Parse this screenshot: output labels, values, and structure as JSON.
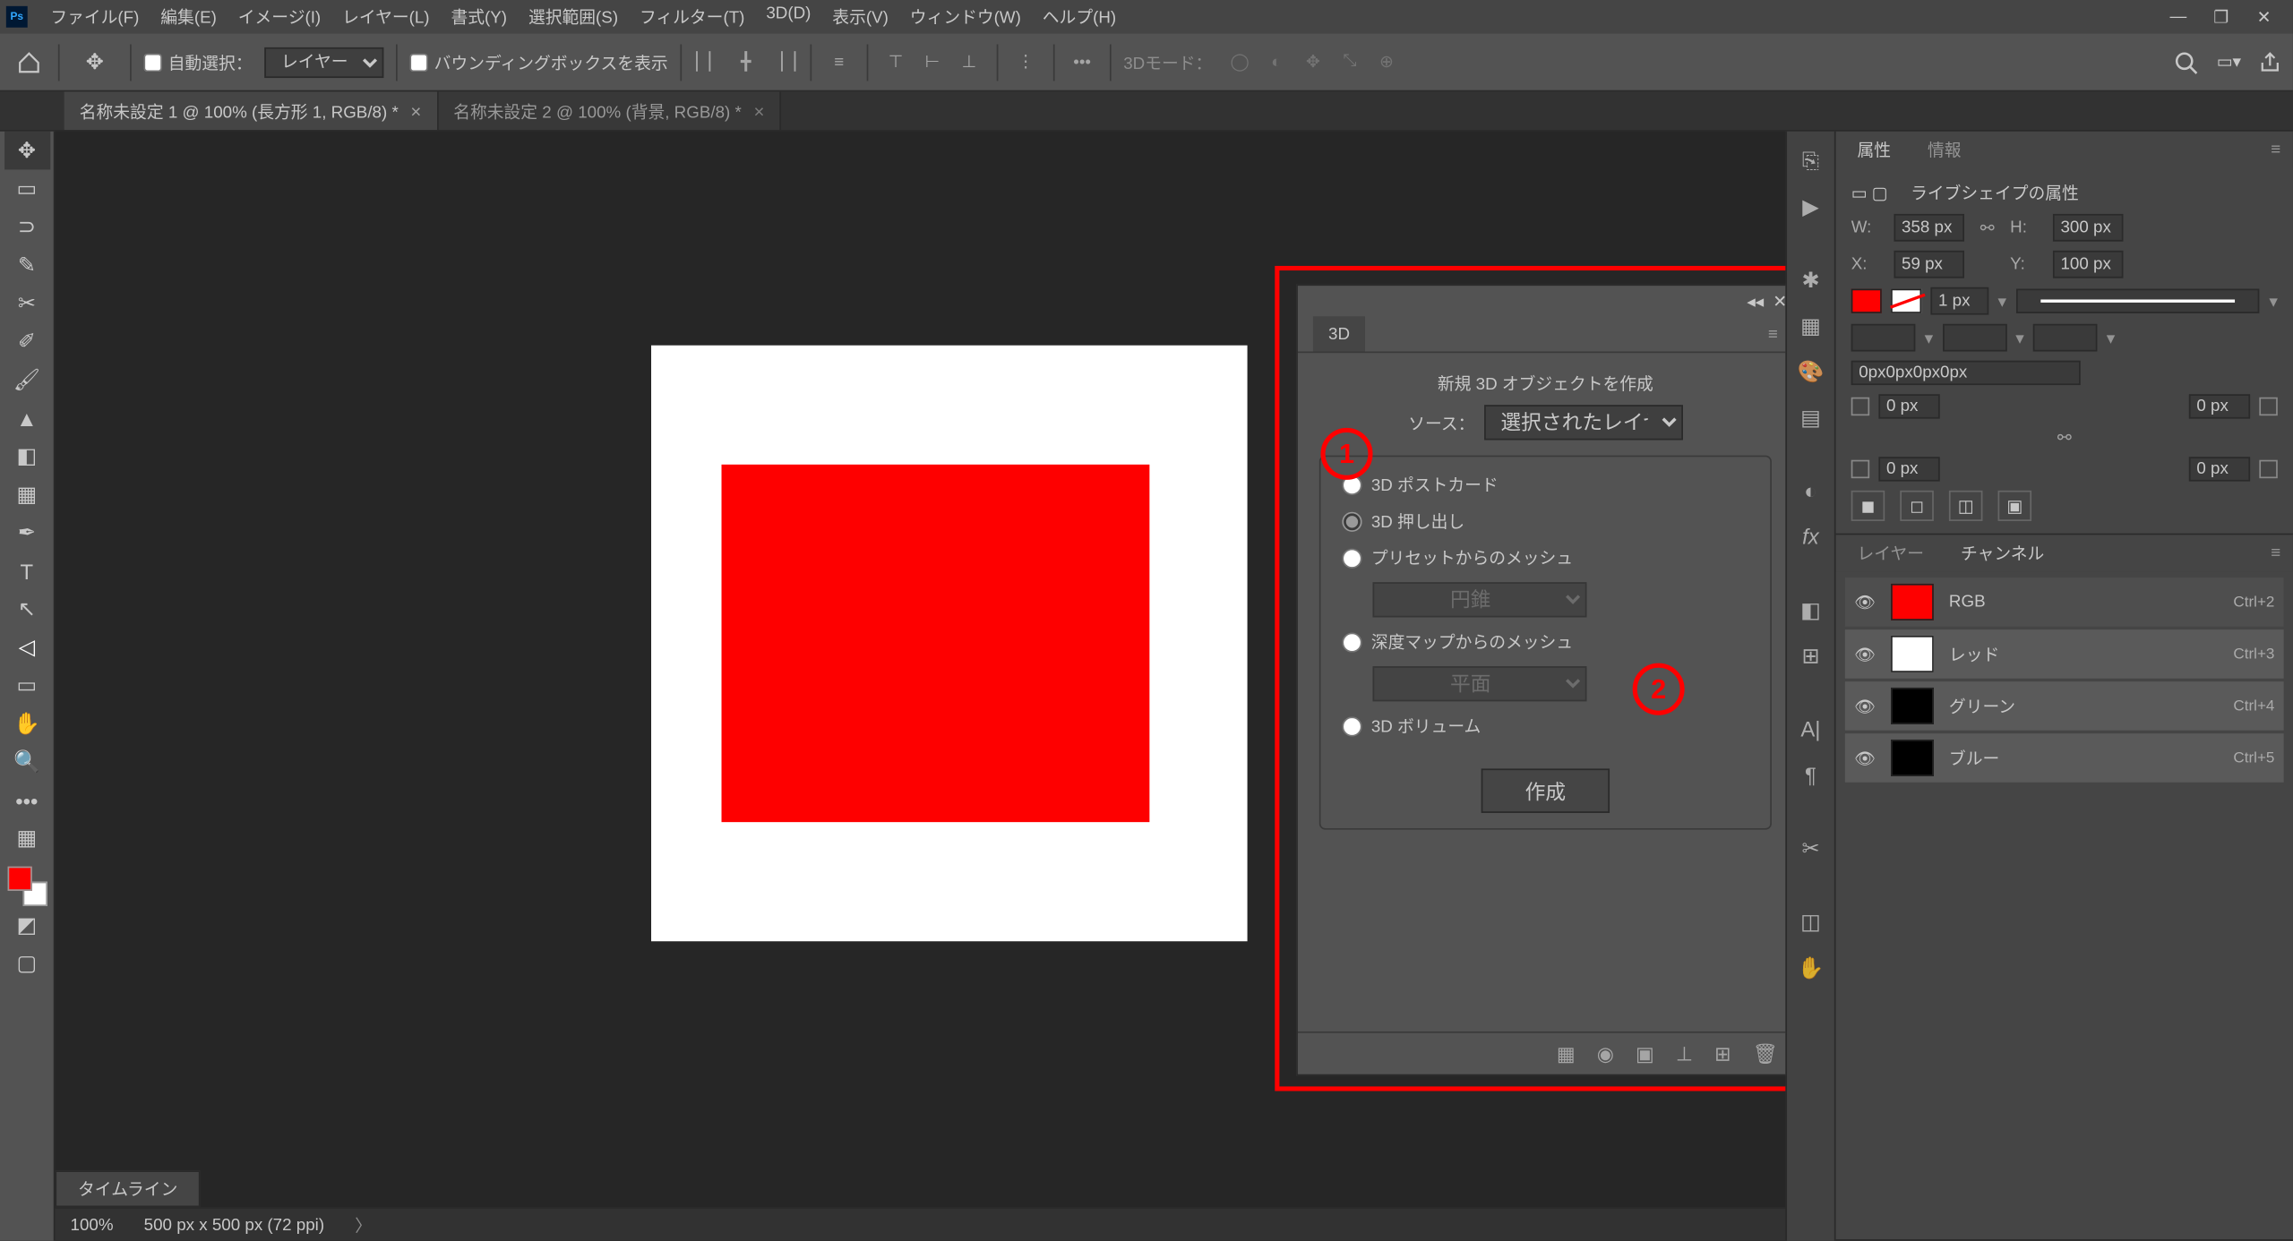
{
  "menubar": [
    "ファイル(F)",
    "編集(E)",
    "イメージ(I)",
    "レイヤー(L)",
    "書式(Y)",
    "選択範囲(S)",
    "フィルター(T)",
    "3D(D)",
    "表示(V)",
    "ウィンドウ(W)",
    "ヘルプ(H)"
  ],
  "options": {
    "auto_select_label": "自動選択：",
    "target_select": "レイヤー",
    "bbox_label": "バウンディングボックスを表示",
    "mode3d_label": "3Dモード："
  },
  "tabs": [
    {
      "title": "名称未設定 1 @ 100% (長方形 1, RGB/8) *",
      "active": true
    },
    {
      "title": "名称未設定 2 @ 100% (背景, RGB/8) *",
      "active": false
    }
  ],
  "status": {
    "zoom": "100%",
    "dims": "500 px x 500 px (72 ppi)",
    "timeline": "タイムライン"
  },
  "panel3d": {
    "tab": "3D",
    "title": "新規 3D オブジェクトを作成",
    "source_label": "ソース：",
    "source_value": "選択されたレイヤー",
    "opt_postcard": "3D ポストカード",
    "opt_extrude": "3D 押し出し",
    "opt_preset": "プリセットからのメッシュ",
    "preset_value": "円錐",
    "opt_depth": "深度マップからのメッシュ",
    "depth_value": "平面",
    "opt_volume": "3D ボリューム",
    "create": "作成"
  },
  "props": {
    "tab_attr": "属性",
    "tab_info": "情報",
    "shape_title": "ライブシェイプの属性",
    "W": "358 px",
    "H": "300 px",
    "X": "59 px",
    "Y": "100 px",
    "stroke_w": "1 px",
    "radius_all": "0px0px0px0px",
    "r_tl": "0 px",
    "r_tr": "0 px",
    "r_bl": "0 px",
    "r_br": "0 px"
  },
  "channels": {
    "tab_layer": "レイヤー",
    "tab_channel": "チャンネル",
    "rows": [
      {
        "name": "RGB",
        "short": "Ctrl+2",
        "color": "#fe0000"
      },
      {
        "name": "レッド",
        "short": "Ctrl+3",
        "color": "#ffffff"
      },
      {
        "name": "グリーン",
        "short": "Ctrl+4",
        "color": "#000000"
      },
      {
        "name": "ブルー",
        "short": "Ctrl+5",
        "color": "#000000"
      }
    ]
  },
  "annotations": {
    "one": "1",
    "two": "2"
  }
}
